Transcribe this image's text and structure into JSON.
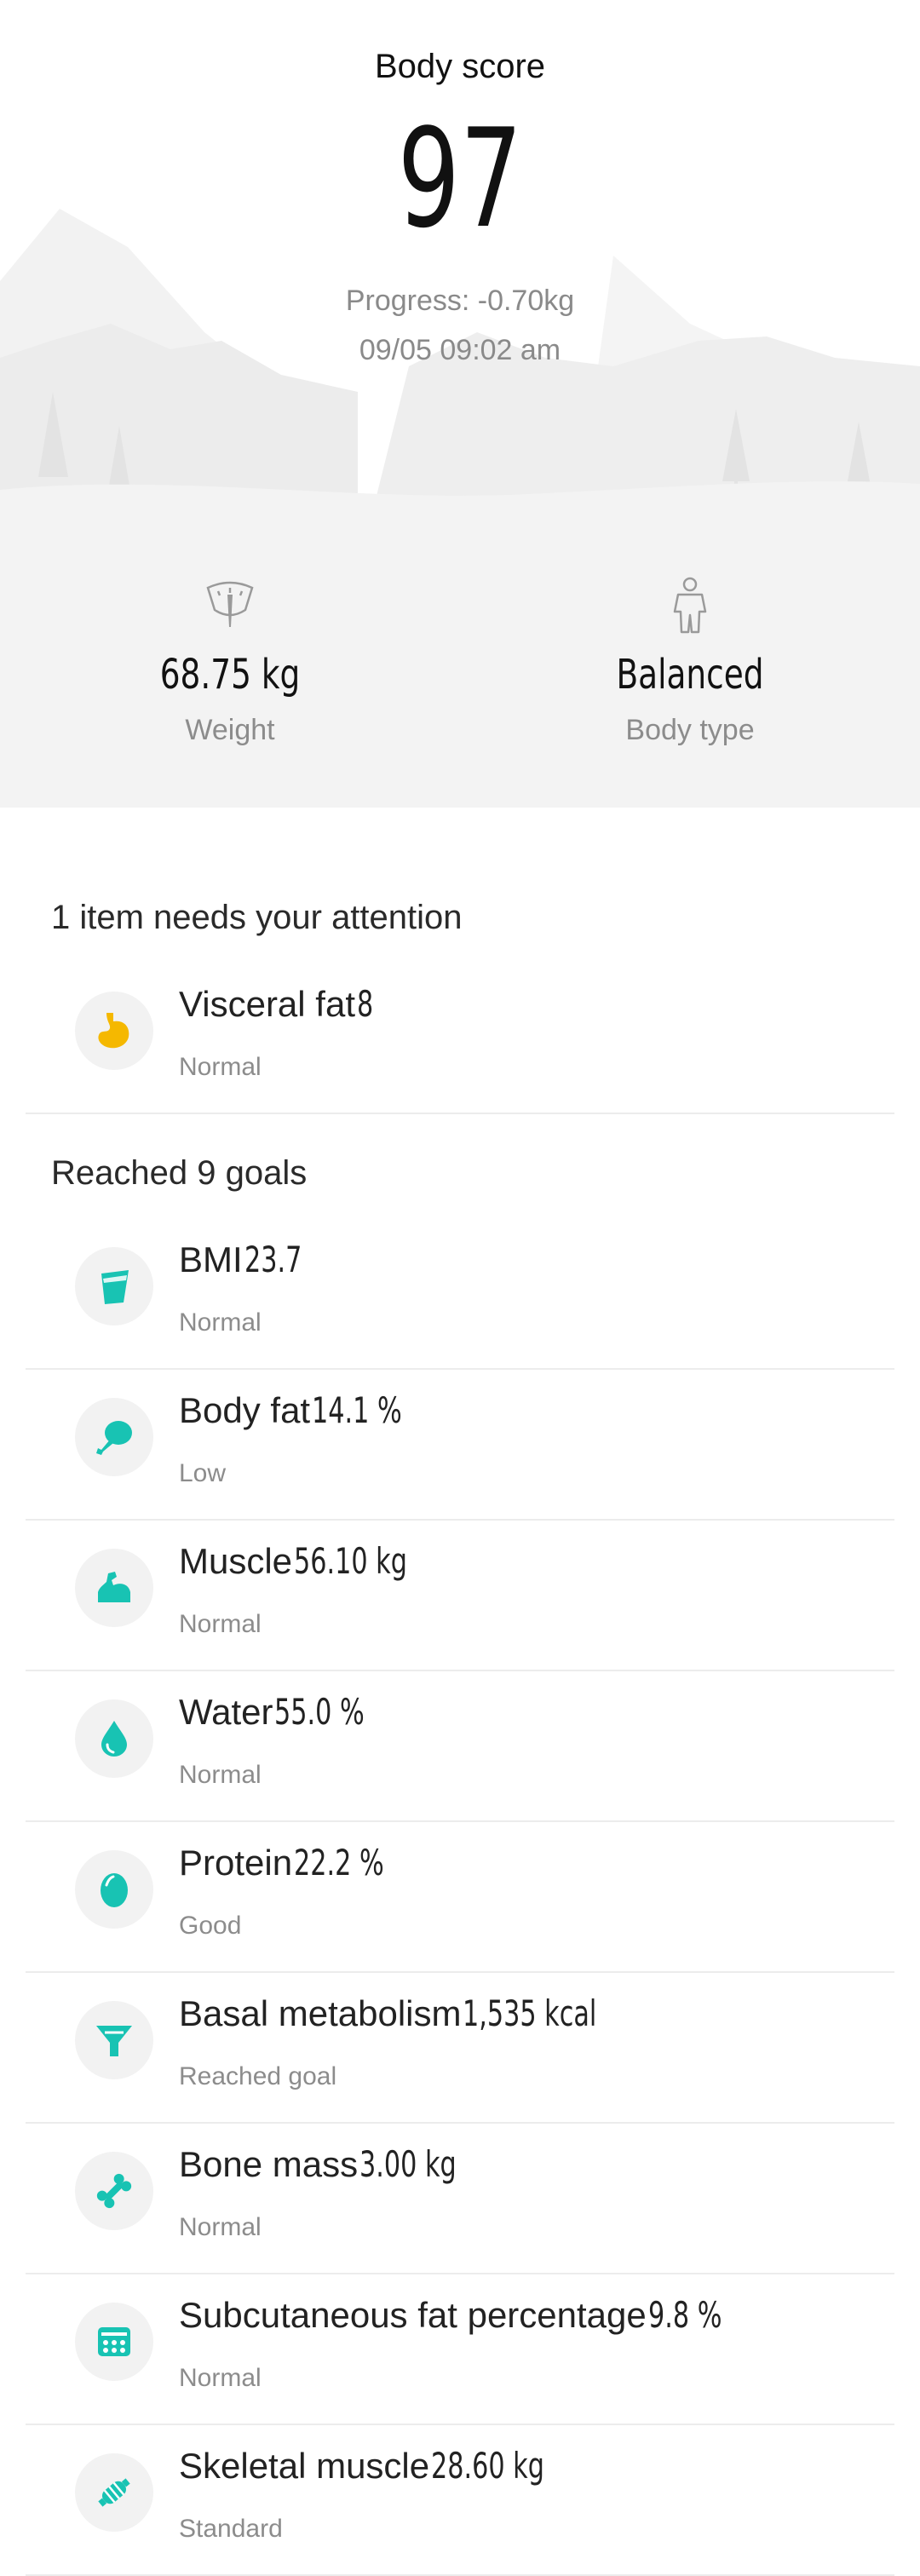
{
  "hero": {
    "title": "Body score",
    "score": "97",
    "progress": "Progress: -0.70kg",
    "date": "09/05 09:02 am"
  },
  "stats": {
    "weight": {
      "value": "68.75 kg",
      "label": "Weight",
      "icon": "scale-icon"
    },
    "body_type": {
      "value": "Balanced",
      "label": "Body type",
      "icon": "person-icon"
    }
  },
  "attention": {
    "title": "1 item needs your attention",
    "items": [
      {
        "name": "Visceral fat",
        "value": "8",
        "status": "Normal",
        "icon": "stomach-icon",
        "color": "#f5b800"
      }
    ]
  },
  "goals": {
    "title": "Reached 9 goals",
    "items": [
      {
        "name": "BMI",
        "value": "23.7",
        "status": "Normal",
        "icon": "cup-icon",
        "color": "#18c3b3"
      },
      {
        "name": "Body fat",
        "value": "14.1 %",
        "status": "Low",
        "icon": "drumstick-icon",
        "color": "#18c3b3"
      },
      {
        "name": "Muscle",
        "value": "56.10 kg",
        "status": "Normal",
        "icon": "bicep-icon",
        "color": "#18c3b3"
      },
      {
        "name": "Water",
        "value": "55.0 %",
        "status": "Normal",
        "icon": "water-drop-icon",
        "color": "#18c3b3"
      },
      {
        "name": "Protein",
        "value": "22.2 %",
        "status": "Good",
        "icon": "egg-icon",
        "color": "#18c3b3"
      },
      {
        "name": "Basal metabolism",
        "value": "1,535  kcal",
        "status": "Reached goal",
        "icon": "funnel-icon",
        "color": "#18c3b3"
      },
      {
        "name": "Bone mass",
        "value": "3.00 kg",
        "status": "Normal",
        "icon": "bone-icon",
        "color": "#18c3b3"
      },
      {
        "name": "Subcutaneous fat percentage",
        "value": "9.8 %",
        "status": "Normal",
        "icon": "grid-icon",
        "color": "#18c3b3"
      },
      {
        "name": "Skeletal muscle",
        "value": "28.60 kg",
        "status": "Standard",
        "icon": "skeletal-muscle-icon",
        "color": "#18c3b3"
      }
    ]
  }
}
